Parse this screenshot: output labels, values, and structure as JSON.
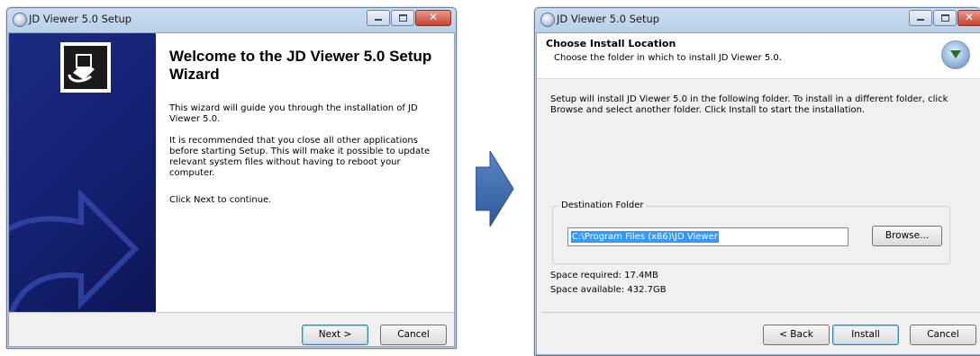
{
  "welcome_window": {
    "title": "JD Viewer 5.0 Setup",
    "heading": "Welcome to the JD Viewer 5.0 Setup Wizard",
    "paragraphs": [
      "This wizard will guide you through the installation of JD Viewer 5.0.",
      "It is recommended that you close all other applications before starting Setup. This will make it possible to update relevant system files without having to reboot your computer.",
      "Click Next to continue."
    ],
    "buttons": {
      "next": "Next >",
      "cancel": "Cancel"
    }
  },
  "location_window": {
    "title": "JD Viewer 5.0 Setup",
    "header_title": "Choose Install Location",
    "header_subtitle": "Choose the folder in which to install JD Viewer 5.0.",
    "body": "Setup will install JD Viewer 5.0 in the following folder. To install in a different folder, click Browse and select another folder. Click Install to start the installation.",
    "group_label": "Destination Folder",
    "destination_value": "C:\\Program Files (x86)\\JD Viewer",
    "browse_label": "Browse...",
    "space_required": "Space required: 17.4MB",
    "space_available": "Space available: 432.7GB",
    "buttons": {
      "back": "< Back",
      "install": "Install",
      "cancel": "Cancel"
    }
  },
  "colors": {
    "sidebar": "#1d2a83",
    "selection": "#3399ff",
    "flow_arrow": "#3f6fb0"
  },
  "icons": [
    "setup-icon",
    "minimize-icon",
    "maximize-icon",
    "close-icon",
    "installer-logo-icon",
    "install-globe-icon",
    "next-step-arrow-icon"
  ]
}
